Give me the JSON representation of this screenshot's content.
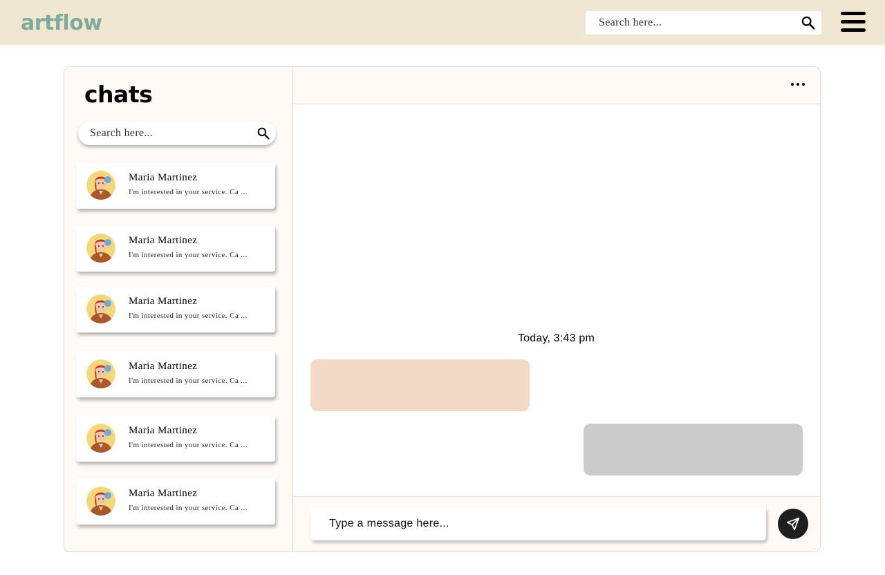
{
  "app": {
    "logo": "artflow"
  },
  "header": {
    "search_placeholder": "Search here...",
    "search_icon": "search-icon",
    "menu_icon": "hamburger-menu-icon"
  },
  "sidebar": {
    "title": "chats",
    "search_placeholder": "Search here...",
    "search_icon": "search-icon",
    "chats": [
      {
        "name": "Maria Martinez",
        "preview": "I'm interested in your service. Ca ...",
        "avatar": "avatar-illustration"
      },
      {
        "name": "Maria Martinez",
        "preview": "I'm interested in your service. Ca ...",
        "avatar": "avatar-illustration"
      },
      {
        "name": "Maria Martinez",
        "preview": "I'm interested in your service. Ca ...",
        "avatar": "avatar-illustration"
      },
      {
        "name": "Maria Martinez",
        "preview": "I'm interested in your service. Ca ...",
        "avatar": "avatar-illustration"
      },
      {
        "name": "Maria Martinez",
        "preview": "I'm interested in your service. Ca ...",
        "avatar": "avatar-illustration"
      },
      {
        "name": "Maria Martinez",
        "preview": "I'm interested in your service. Ca ...",
        "avatar": "avatar-illustration"
      }
    ]
  },
  "conversation": {
    "more_icon": "more-horizontal-icon",
    "timestamp": "Today, 3:43 pm",
    "composer_placeholder": "Type a message here...",
    "send_icon": "send-icon"
  },
  "colors": {
    "topbar_bg": "#efe7d0",
    "logo": "#7fa99a",
    "panel_bg": "#fffaf6",
    "incoming_bubble": "#f1d9c6",
    "outgoing_bubble": "#cbcbcb",
    "send_button": "#1f1f1f"
  }
}
